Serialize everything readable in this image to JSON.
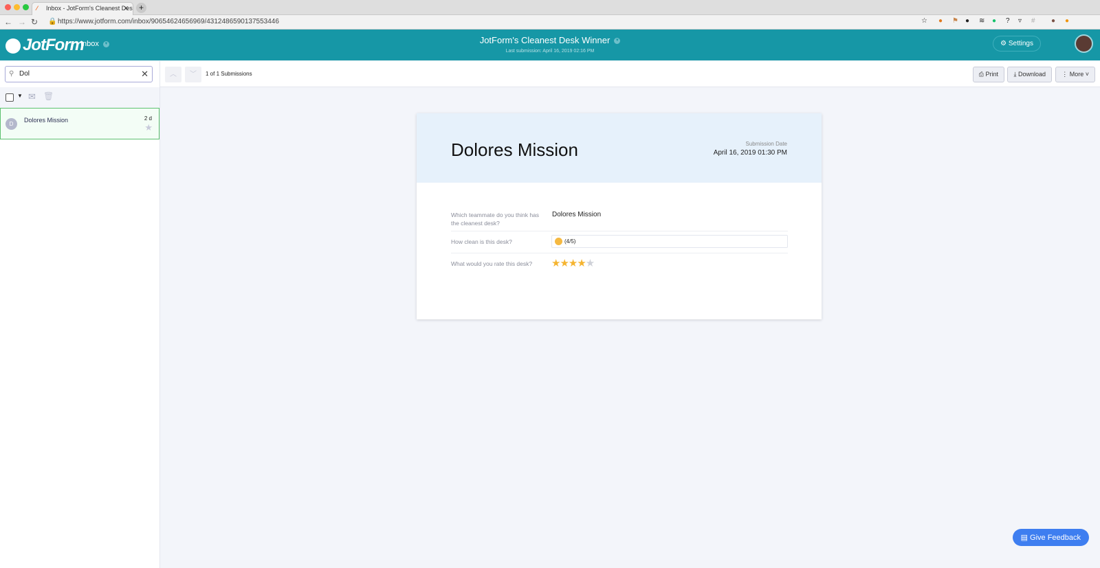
{
  "browser": {
    "tab_title": "Inbox - JotForm's Cleanest Des",
    "url": "https://www.jotform.com/inbox/90654624656969/4312486590137553446"
  },
  "header": {
    "logo": "JotForm",
    "inbox_label": "Inbox",
    "form_title": "JotForm's Cleanest Desk Winner",
    "last_submission": "Last submission:  April 16, 2019 02:16 PM",
    "settings_label": "Settings"
  },
  "sidebar": {
    "search_value": "Dol",
    "items": [
      {
        "initial": "D",
        "name": "Dolores Mission",
        "time": "2 d"
      }
    ]
  },
  "toolbar": {
    "count": "1 of 1 Submissions",
    "print": "Print",
    "download": "Download",
    "more": "More"
  },
  "submission": {
    "name": "Dolores Mission",
    "date_label": "Submission Date",
    "date": "April 16, 2019 01:30 PM",
    "fields": [
      {
        "q": "Which teammate do you think has the cleanest desk?",
        "a": "Dolores Mission"
      },
      {
        "q": "How clean is this desk?",
        "a": "(4/5)"
      },
      {
        "q": "What would you rate this desk?",
        "rating": 4,
        "max": 5
      }
    ]
  },
  "feedback": "Give Feedback"
}
